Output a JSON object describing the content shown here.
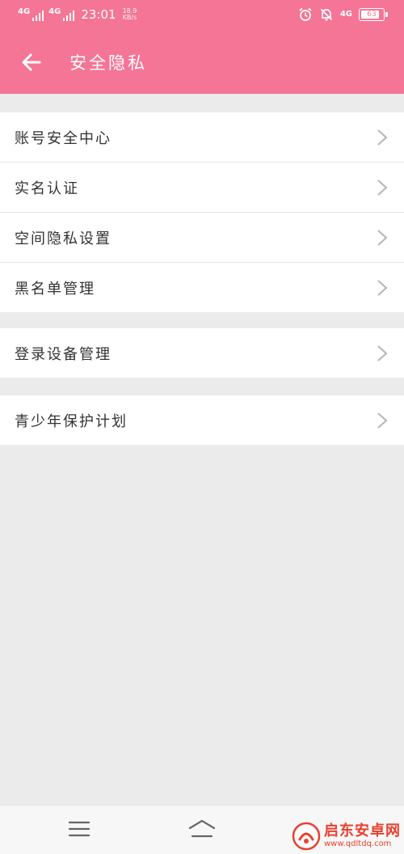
{
  "status_bar": {
    "signal1_label": "4G",
    "signal2_label": "4G",
    "time": "23:01",
    "speed_value": "18.9",
    "speed_unit": "KB/s",
    "network_label": "4G",
    "battery_level": "63"
  },
  "header": {
    "title": "安全隐私",
    "back_icon": "arrow-left-icon",
    "background_color": "#f47595"
  },
  "groups": [
    {
      "items": [
        {
          "label": "账号安全中心"
        },
        {
          "label": "实名认证"
        },
        {
          "label": "空间隐私设置"
        },
        {
          "label": "黑名单管理"
        }
      ]
    },
    {
      "items": [
        {
          "label": "登录设备管理"
        }
      ]
    },
    {
      "items": [
        {
          "label": "青少年保护计划"
        }
      ]
    }
  ],
  "nav_bar": {
    "menu_icon": "menu-icon",
    "home_icon": "home-icon"
  },
  "watermark": {
    "title": "启东安卓网",
    "url": "www.qdltdq.com"
  }
}
